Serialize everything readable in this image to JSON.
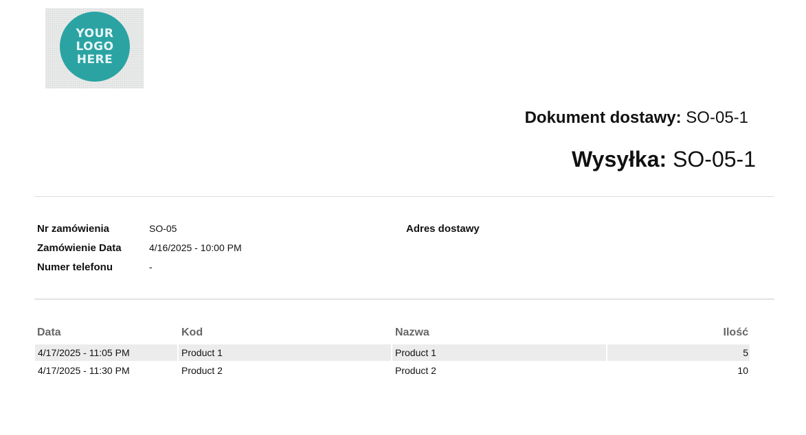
{
  "logo": {
    "text": [
      "YOUR",
      "LOGO",
      "HERE"
    ]
  },
  "header": {
    "document_label": "Dokument dostawy:",
    "document_value": "SO-05-1",
    "shipment_label": "Wysyłka:",
    "shipment_value": "SO-05-1"
  },
  "info": {
    "order_no_label": "Nr zamówienia",
    "order_no_value": "SO-05",
    "order_date_label": "Zamówienie Data",
    "order_date_value": "4/16/2025 - 10:00 PM",
    "phone_label": "Numer telefonu",
    "phone_value": "-",
    "address_label": "Adres dostawy"
  },
  "table": {
    "columns": [
      "Data",
      "Kod",
      "Nazwa",
      "Ilość"
    ],
    "rows": [
      [
        "4/17/2025 - 11:05 PM",
        "Product 1",
        "Product 1",
        "5"
      ],
      [
        "4/17/2025 - 11:30 PM",
        "Product 2",
        "Product 2",
        "10"
      ]
    ]
  },
  "colors": {
    "logo_circle": "#2ba3a3",
    "row_shade": "#ececec",
    "header_text": "#666666"
  }
}
